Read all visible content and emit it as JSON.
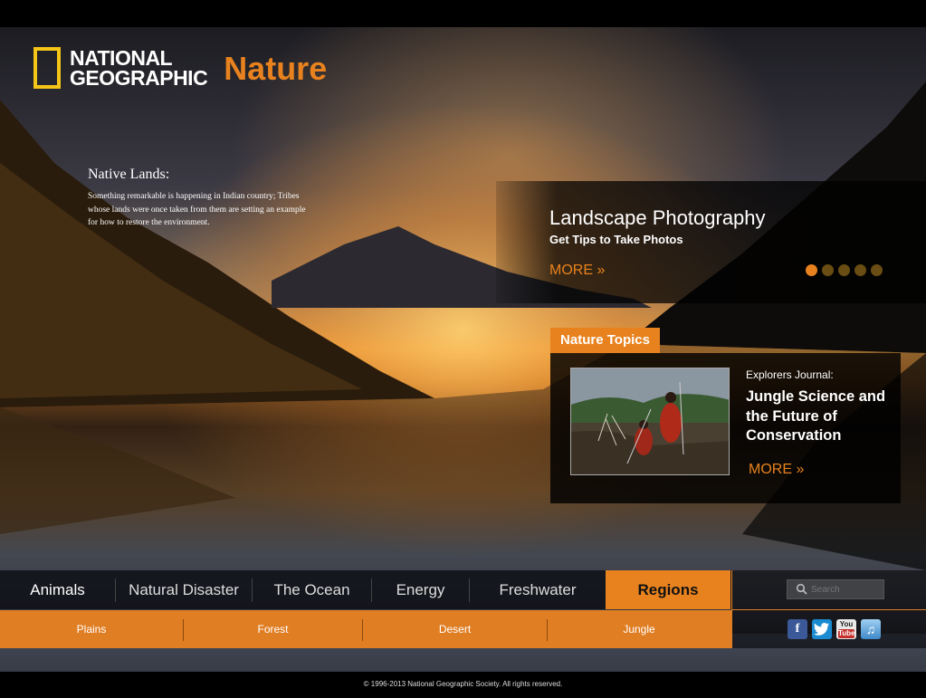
{
  "brand": {
    "line1": "NATIONAL",
    "line2": "GEOGRAPHIC",
    "section": "Nature"
  },
  "native": {
    "title": "Native Lands:",
    "text": "Something remarkable is happening in Indian country; Tribes whose lands were once taken from them are setting an example for how to restore the environment."
  },
  "feature": {
    "title": "Landscape Photography",
    "subtitle": "Get Tips to Take Photos",
    "more": "MORE »",
    "slides": 5,
    "active_slide": 1
  },
  "topics": {
    "tab": "Nature Topics",
    "kicker": "Explorers Journal:",
    "title": "Jungle Science and  the Future of Conservation",
    "more": "MORE »"
  },
  "nav": {
    "items": [
      "Animals",
      "Natural Disaster",
      "The Ocean",
      "Energy",
      "Freshwater",
      "Regions"
    ],
    "active": "Regions"
  },
  "subnav": {
    "items": [
      "Plains",
      "Forest",
      "Desert",
      "Jungle"
    ]
  },
  "search": {
    "placeholder": "Search"
  },
  "social": {
    "icons": [
      "facebook-icon",
      "twitter-icon",
      "youtube-icon",
      "itunes-icon"
    ]
  },
  "footer": {
    "text": "© 1996-2013 National Geographic Society. All rights reserved."
  },
  "colors": {
    "accent": "#e8821e",
    "logo_yellow": "#f5c518"
  }
}
